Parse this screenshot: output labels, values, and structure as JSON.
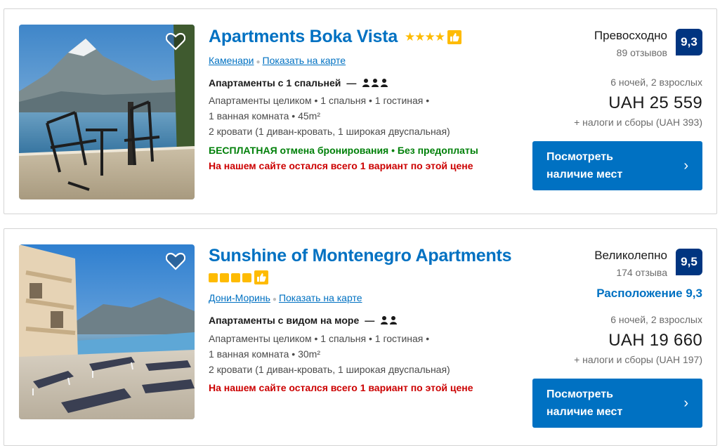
{
  "listings": [
    {
      "title": "Apartments Boka Vista",
      "rating_stars": "★★★★",
      "location": "Каменари",
      "map_link": "Показать на карте",
      "unit_type": "Апартаменты с 1 спальней",
      "unit_dash": "—",
      "desc_line1": "Апартаменты целиком  • 1 спальня • 1 гостиная •",
      "desc_line2": "1 ванная комната • 45m²",
      "desc_line3": "2 кровати (1 диван-кровать, 1 широкая двуспальная)",
      "free_cancel": "БЕСПЛАТНАЯ отмена бронирования • Без предоплаты",
      "availability_note": "На нашем сайте остался всего 1 вариант по этой цене",
      "score_word": "Превосходно",
      "reviews": "89 отзывов",
      "score": "9,3",
      "nights": "6 ночей, 2 взрослых",
      "price": "UAH 25 559",
      "taxes": "+ налоги и сборы (UAH 393)",
      "cta": "Посмотреть наличие мест",
      "cta_icon": "chevron-right-icon"
    },
    {
      "title": "Sunshine of Montenegro Apartments",
      "location": "Дони-Моринь",
      "map_link": "Показать на карте",
      "unit_type": "Апартаменты с видом на море",
      "unit_dash": "—",
      "desc_line1": "Апартаменты целиком  • 1 спальня • 1 гостиная •",
      "desc_line2": "1 ванная комната • 30m²",
      "desc_line3": "2 кровати (1 диван-кровать, 1 широкая двуспальная)",
      "availability_note": "На нашем сайте остался всего 1 вариант по этой цене",
      "score_word": "Великолепно",
      "reviews": "174 отзыва",
      "score": "9,5",
      "location_score": "Расположение 9,3",
      "nights": "6 ночей, 2 взрослых",
      "price": "UAH 19 660",
      "taxes": "+ налоги и сборы (UAH 197)",
      "cta": "Посмотреть наличие мест",
      "cta_icon": "chevron-right-icon"
    }
  ],
  "colors": {
    "link_blue": "#0071c2",
    "badge_navy": "#003580",
    "star_yellow": "#febb02",
    "green": "#008009",
    "red": "#cc0000"
  }
}
